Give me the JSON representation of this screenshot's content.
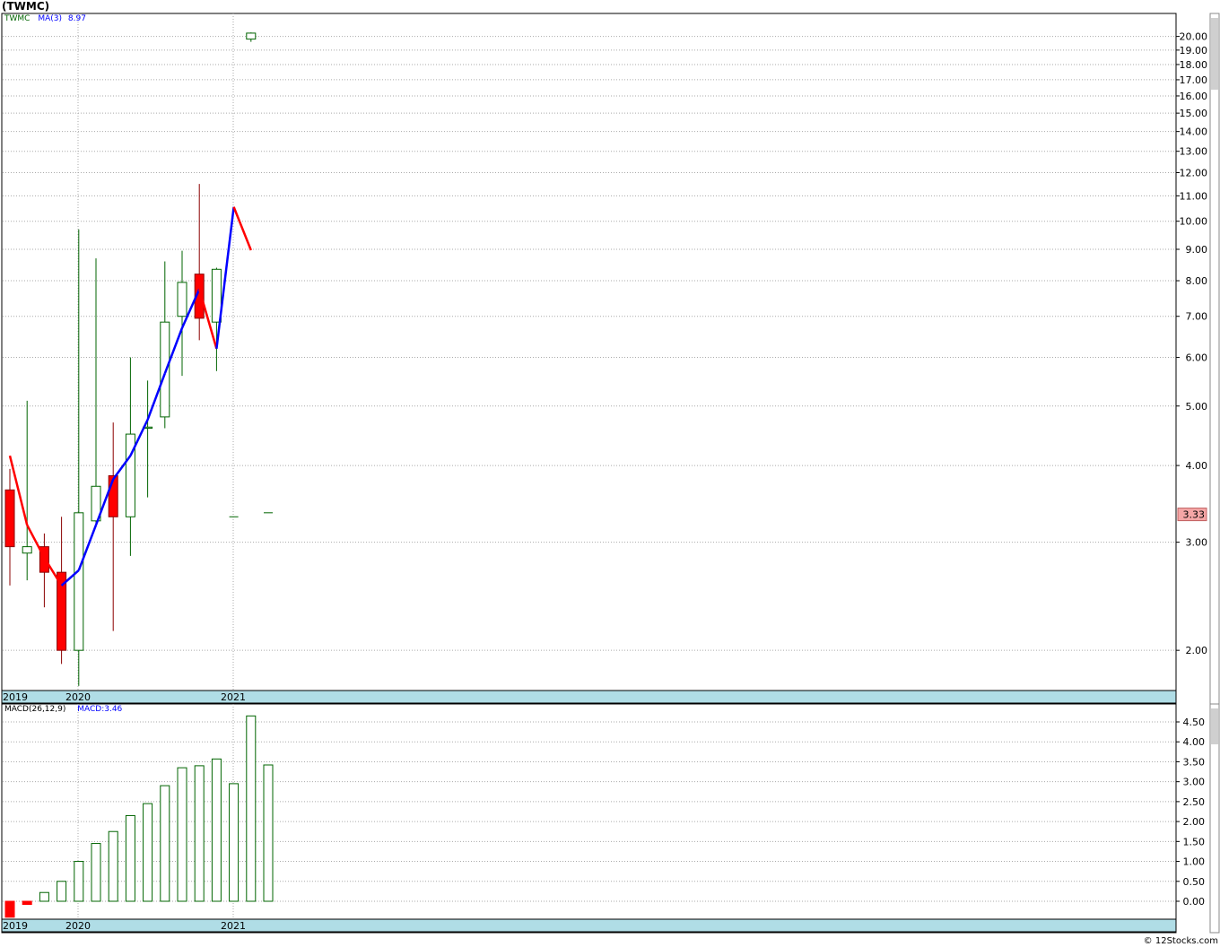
{
  "title": "(TWMC)",
  "price_legend": {
    "symbol": "TWMC",
    "ma_label": "MA(3)",
    "ma_value": "8.97"
  },
  "macd_legend": {
    "label": "MACD(26,12,9)",
    "value_label": "MACD:3.46"
  },
  "last_price_label": "3.33",
  "footer": "© 12Stocks.com",
  "colors": {
    "up": "#006400",
    "down": "#ff0000",
    "ma_up": "#0000ff",
    "ma_down": "#ff0000",
    "axis_band": "#b0dde6",
    "grid": "#aaaaaa",
    "last_price_bg": "#f4a6a6"
  },
  "chart_data": [
    {
      "type": "candlestick",
      "title": "(TWMC)",
      "scale": "log",
      "ylim": [
        1.72,
        21.8
      ],
      "y_ticks": [
        "2.00",
        "3.00",
        "4.00",
        "5.00",
        "6.00",
        "7.00",
        "8.00",
        "9.00",
        "10.00",
        "11.00",
        "12.00",
        "13.00",
        "14.00",
        "15.00",
        "16.00",
        "17.00",
        "18.00",
        "19.00",
        "20.00"
      ],
      "x_labels": [
        "2019",
        "2020",
        "2021"
      ],
      "candles": [
        {
          "open": 3.65,
          "close": 2.95,
          "high": 3.95,
          "low": 2.55
        },
        {
          "open": 2.88,
          "close": 2.95,
          "high": 5.1,
          "low": 2.6
        },
        {
          "open": 2.95,
          "close": 2.68,
          "high": 3.1,
          "low": 2.35
        },
        {
          "open": 2.68,
          "close": 2.0,
          "high": 3.3,
          "low": 1.9
        },
        {
          "open": 2.0,
          "close": 3.35,
          "high": 9.7,
          "low": 1.75
        },
        {
          "open": 3.25,
          "close": 3.7,
          "high": 8.7,
          "low": 3.2
        },
        {
          "open": 3.85,
          "close": 3.3,
          "high": 4.7,
          "low": 2.15
        },
        {
          "open": 3.3,
          "close": 4.5,
          "high": 6.0,
          "low": 2.85
        },
        {
          "open": 4.6,
          "close": 4.62,
          "high": 5.5,
          "low": 3.55
        },
        {
          "open": 4.8,
          "close": 6.85,
          "high": 8.6,
          "low": 4.6
        },
        {
          "open": 7.0,
          "close": 7.95,
          "high": 8.95,
          "low": 5.6
        },
        {
          "open": 8.2,
          "close": 6.95,
          "high": 11.5,
          "low": 6.4
        },
        {
          "open": 6.85,
          "close": 8.35,
          "high": 8.4,
          "low": 5.7
        },
        {
          "open": 3.3,
          "close": 3.3,
          "high": 3.3,
          "low": 3.3
        },
        {
          "open": 19.8,
          "close": 20.25,
          "high": 20.3,
          "low": 19.6
        },
        {
          "open": 3.35,
          "close": 3.35,
          "high": 3.35,
          "low": 3.35
        }
      ],
      "ma": {
        "name": "MA(3)",
        "values": [
          4.15,
          3.2,
          2.83,
          2.55,
          2.7,
          3.2,
          3.8,
          4.15,
          4.75,
          5.65,
          6.7,
          7.75,
          6.2,
          10.55,
          8.97
        ]
      }
    },
    {
      "type": "bar",
      "title": "MACD(26,12,9)",
      "ylim": [
        -0.45,
        4.95
      ],
      "y_ticks": [
        "0.00",
        "0.50",
        "1.00",
        "1.50",
        "2.00",
        "2.50",
        "3.00",
        "3.50",
        "4.00",
        "4.50"
      ],
      "x_labels": [
        "2019",
        "2020",
        "2021"
      ],
      "values": [
        -0.4,
        -0.08,
        0.22,
        0.5,
        1.0,
        1.45,
        1.75,
        2.15,
        2.45,
        2.9,
        3.35,
        3.4,
        3.57,
        2.95,
        4.65,
        3.42
      ]
    }
  ]
}
